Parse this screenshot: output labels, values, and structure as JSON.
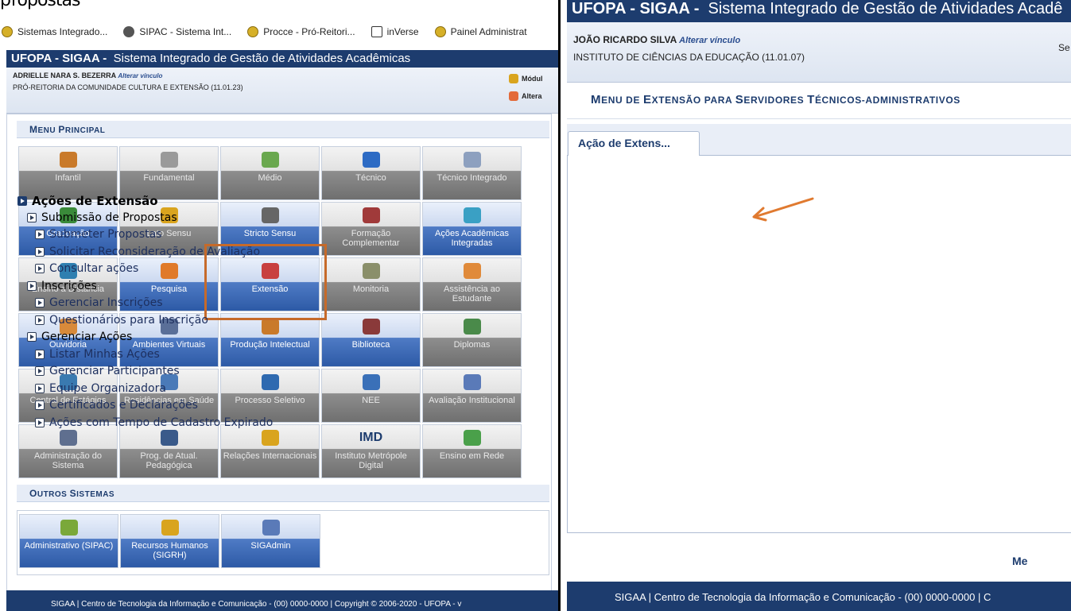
{
  "left": {
    "bookmarks": [
      {
        "label": "Sistemas Integrado...",
        "icon": "gov-icon"
      },
      {
        "label": "SIPAC - Sistema Int...",
        "icon": "gear-icon"
      },
      {
        "label": "Procce - Pró-Reitori...",
        "icon": "gov-icon"
      },
      {
        "label": "inVerse",
        "icon": "inverse-icon"
      },
      {
        "label": "Painel Administrat",
        "icon": "gov-icon"
      }
    ],
    "header": {
      "system": "UFOPA - SIGAA -",
      "subtitle": "Sistema Integrado de Gestão de Atividades Acadêmicas"
    },
    "user": {
      "name": "ADRIELLE NARA S. BEZERRA",
      "change_link": "Alterar vínculo",
      "unit": "PRÓ-REITORIA DA COMUNIDADE CULTURA E EXTENSÃO (11.01.23)"
    },
    "side_links": [
      "Módul",
      "Altera"
    ],
    "menu_title": {
      "cap": "M",
      "rest": "ENU ",
      "cap2": "P",
      "rest2": "RINCIPAL"
    },
    "tiles": [
      {
        "label": "Infantil",
        "style": "gray",
        "icon_color": "#c97a2a"
      },
      {
        "label": "Fundamental",
        "style": "gray",
        "icon_color": "#9a9a9a"
      },
      {
        "label": "Médio",
        "style": "gray",
        "icon_color": "#6aa84f"
      },
      {
        "label": "Técnico",
        "style": "gray",
        "icon_color": "#2d6bc4"
      },
      {
        "label": "Técnico Integrado",
        "style": "gray",
        "icon_color": "#8da0bf"
      },
      {
        "label": "Graduação",
        "style": "blue",
        "icon_color": "#3a8a3a"
      },
      {
        "label": "Lato Sensu",
        "style": "gray",
        "icon_color": "#d9a41e"
      },
      {
        "label": "Stricto Sensu",
        "style": "blue",
        "icon_color": "#666666"
      },
      {
        "label": "Formação Complementar",
        "style": "gray",
        "icon_color": "#a03a3a"
      },
      {
        "label": "Ações Acadêmicas Integradas",
        "style": "blue",
        "icon_color": "#3aa0c4"
      },
      {
        "label": "Ensino a Distância",
        "style": "gray",
        "icon_color": "#2f7fb0"
      },
      {
        "label": "Pesquisa",
        "style": "blue",
        "icon_color": "#e07a2a"
      },
      {
        "label": "Extensão",
        "style": "blue",
        "icon_color": "#c84040"
      },
      {
        "label": "Monitoria",
        "style": "gray",
        "icon_color": "#8a8f6a"
      },
      {
        "label": "Assistência ao Estudante",
        "style": "gray",
        "icon_color": "#e08a3a"
      },
      {
        "label": "Ouvidoria",
        "style": "blue",
        "icon_color": "#d88a3a"
      },
      {
        "label": "Ambientes Virtuais",
        "style": "blue",
        "icon_color": "#5a6f98"
      },
      {
        "label": "Produção Intelectual",
        "style": "blue",
        "icon_color": "#c97a2a"
      },
      {
        "label": "Biblioteca",
        "style": "blue",
        "icon_color": "#8a3a3a"
      },
      {
        "label": "Diplomas",
        "style": "gray",
        "icon_color": "#4a8a4a"
      },
      {
        "label": "Central de Estágios",
        "style": "gray",
        "icon_color": "#3a7ab0"
      },
      {
        "label": "Residências em Saúde",
        "style": "gray",
        "icon_color": "#4a7ab8"
      },
      {
        "label": "Processo Seletivo",
        "style": "gray",
        "icon_color": "#2f6ab0"
      },
      {
        "label": "NEE",
        "style": "gray",
        "icon_color": "#3a70b8"
      },
      {
        "label": "Avaliação Institucional",
        "style": "gray",
        "icon_color": "#5a7ab8"
      },
      {
        "label": "Administração do Sistema",
        "style": "gray",
        "icon_color": "#5f6f8f"
      },
      {
        "label": "Prog. de Atual. Pedagógica",
        "style": "gray",
        "icon_color": "#3a5a8a"
      },
      {
        "label": "Relações Internacionais",
        "style": "gray",
        "icon_color": "#d9a41e"
      },
      {
        "label": "Instituto Metrópole Digital",
        "style": "gray",
        "icon_color": "#1d3c6e",
        "glyph": "IMD"
      },
      {
        "label": "Ensino em Rede",
        "style": "gray",
        "icon_color": "#4aa04a"
      }
    ],
    "outros_title": {
      "cap": "O",
      "rest": "UTROS ",
      "cap2": "S",
      "rest2": "ISTEMAS"
    },
    "outros_tiles": [
      {
        "label": "Administrativo (SIPAC)",
        "style": "blue",
        "icon_color": "#7aa83a"
      },
      {
        "label": "Recursos Humanos (SIGRH)",
        "style": "blue",
        "icon_color": "#d9a41e"
      },
      {
        "label": "SIGAdmin",
        "style": "blue",
        "icon_color": "#5a7ab8"
      }
    ],
    "footer": "SIGAA | Centro de Tecnologia da Informação e Comunicação - (00) 0000-0000 | Copyright © 2006-2020 - UFOPA - v"
  },
  "right": {
    "header": {
      "system": "UFOPA - SIGAA -",
      "subtitle": "Sistema Integrado de Gestão de Atividades Acadê"
    },
    "user": {
      "name": "JOÃO RICARDO SILVA",
      "change_link": "Alterar vínculo",
      "unit": "INSTITUTO DE CIÊNCIAS DA EDUCAÇÃO (11.01.07)",
      "side": "Se"
    },
    "menu_title": {
      "c1": "M",
      "r1": "ENU DE ",
      "c2": "E",
      "r2": "XTENSÃO PARA ",
      "c3": "S",
      "r3": "ERVIDORES ",
      "c4": "T",
      "r4": "ÉCNICOS-ADMINISTRATIVOS"
    },
    "tab": "Ação de Extens...",
    "tree": {
      "root": "Ações de Extensão",
      "groups": [
        {
          "label": "Submissão de Propostas",
          "items": [
            "Submeter Propostas",
            "Solicitar Reconsideração de Avaliação",
            "Consultar ações"
          ]
        },
        {
          "label": "Inscrições",
          "items": [
            "Gerenciar Inscrições",
            "Questionários para Inscrição"
          ]
        },
        {
          "label": "Gerenciar Ações",
          "items": [
            "Listar Minhas Ações",
            "Gerenciar Participantes",
            "Equipe Organizadora",
            "Certificados e Declarações",
            "Ações com Tempo de Cadastro Expirado"
          ]
        }
      ]
    },
    "footer_link": "Me",
    "footer": "SIGAA | Centro de Tecnologia da Informação e Comunicação - (00) 0000-0000 | C"
  },
  "colors": {
    "accent": "#1d3c6e",
    "highlight": "#c66a2a",
    "arrow": "#e07a30"
  }
}
